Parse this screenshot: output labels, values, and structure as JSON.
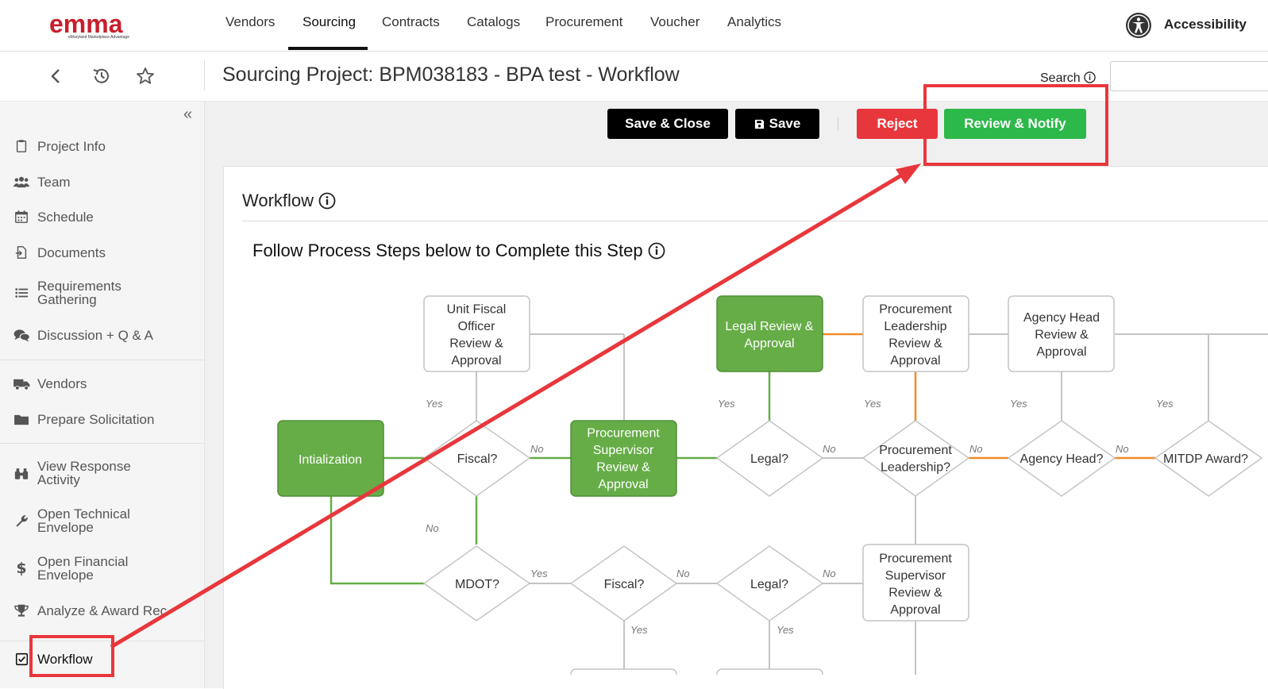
{
  "nav": {
    "items": [
      "Vendors",
      "Sourcing",
      "Contracts",
      "Catalogs",
      "Procurement",
      "Voucher",
      "Analytics"
    ],
    "active": "Sourcing",
    "accessibility_label": "Accessibility"
  },
  "logo": {
    "text": "emma",
    "tagline": "eMaryland Marketplace Advantage"
  },
  "subheader": {
    "title": "Sourcing Project: BPM038183 - BPA test - Workflow",
    "search_label": "Search",
    "search_value": ""
  },
  "sidebar": {
    "collapse": "«",
    "items": [
      {
        "label": "Project Info",
        "icon": "clipboard-icon"
      },
      {
        "label": "Team",
        "icon": "users-icon"
      },
      {
        "label": "Schedule",
        "icon": "calendar-icon"
      },
      {
        "label": "Documents",
        "icon": "document-icon"
      },
      {
        "label": "Requirements Gathering",
        "icon": "list-icon"
      },
      {
        "label": "Discussion + Q & A",
        "icon": "comments-icon"
      },
      {
        "label": "Vendors",
        "icon": "truck-icon"
      },
      {
        "label": "Prepare Solicitation",
        "icon": "folder-icon"
      },
      {
        "label": "View Response Activity",
        "icon": "binoculars-icon"
      },
      {
        "label": "Open Technical Envelope",
        "icon": "wrench-icon"
      },
      {
        "label": "Open Financial Envelope",
        "icon": "dollar-icon"
      },
      {
        "label": "Analyze & Award Rec",
        "icon": "trophy-icon"
      },
      {
        "label": "Workflow",
        "icon": "checkbox-icon"
      }
    ]
  },
  "actions": {
    "save_close": "Save & Close",
    "save": "Save",
    "reject": "Reject",
    "review_notify": "Review & Notify"
  },
  "workflow": {
    "title": "Workflow",
    "subtitle": "Follow Process Steps below to Complete this Step",
    "steps": {
      "init": "Intialization",
      "unit_fiscal": "Unit Fiscal Officer Review & Approval",
      "proc_supervisor": "Procurement Supervisor Review & Approval",
      "legal_review": "Legal Review & Approval",
      "proc_leadership": "Procurement Leadership Review & Approval",
      "agency_head": "Agency Head Review & Approval",
      "proc_supervisor_2": "Procurement Supervisor Review & Approval"
    },
    "decisions": {
      "fiscal": "Fiscal?",
      "legal": "Legal?",
      "proc_leadership": "Procurement Leadership?",
      "agency_head": "Agency Head?",
      "mitdp": "MITDP Award?",
      "mdot": "MDOT?",
      "fiscal_2": "Fiscal?",
      "legal_2": "Legal?"
    },
    "edge_labels": {
      "yes": "Yes",
      "no": "No"
    }
  },
  "colors": {
    "green_step": "#66ad47",
    "orange_line": "#ee8a2a",
    "gray_line": "#c4c4c4",
    "highlight": "#e8373c",
    "green_button": "#2db84a",
    "red_button": "#e8373c"
  }
}
